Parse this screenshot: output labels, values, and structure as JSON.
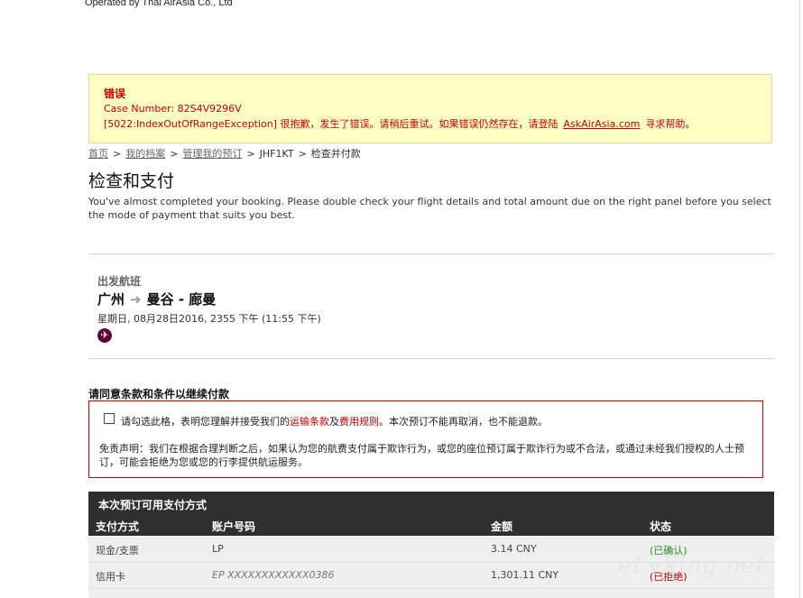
{
  "operated_by": "Operated by Thai AirAsia Co., Ltd",
  "error": {
    "title": "错误",
    "case_number": "Case Number: 82S4V9296V",
    "message_prefix": "[5022:IndexOutOfRangeException] 很抱歉，发生了错误。请稍后重试。如果错误仍然存在，请登陆",
    "link_text": "AskAirAsia.com",
    "message_suffix": "寻求帮助。"
  },
  "breadcrumb": {
    "items": [
      "首页",
      "我的档案",
      "管理我的预订"
    ],
    "booking_code": "JHF1KT",
    "current": "检查并付款",
    "separator": ">"
  },
  "page_title": "检查和支付",
  "intro": "You've almost completed your booking. Please double check your flight details and total amount due on the right panel before you select the mode of payment that suits you best.",
  "flight": {
    "label": "出发航班",
    "origin": "广州",
    "destination": "曼谷 - 廊曼",
    "datetime": "星期日, 08月28日2016, 2355 下午 (11:55 下午)"
  },
  "terms": {
    "heading": "请同意条款和条件以继续付款",
    "agree_prefix": "请勾选此格，表明您理解并接受我们的",
    "link1": "运输条款",
    "and": "及",
    "link2": "费用规则",
    "agree_suffix": "。本次预订不能再取消，也不能退款。",
    "disclaimer": "免责声明：我们在根据合理判断之后，如果认为您的航费支付属于欺诈行为，或您的座位预订属于欺诈行为或不合法，或通过未经我们授权的人士预订，可能会拒绝为您或您的行李提供航运服务。"
  },
  "payments": {
    "title": "本次预订可用支付方式",
    "columns": [
      "支付方式",
      "账户号码",
      "金额",
      "状态"
    ],
    "rows": [
      {
        "method": "现金/支票",
        "account": "LP",
        "amount": "3.14 CNY",
        "status": "(已确认)"
      },
      {
        "method": "信用卡",
        "account": "EP  XXXXXXXXXXXX0386",
        "amount": "1,301.11 CNY",
        "status": "(已拒绝)"
      }
    ]
  },
  "watermark": "eLvXing.net",
  "colors": {
    "error_red": "#c00000",
    "error_bg": "#ffffc4",
    "header_dark": "#2f2f2f",
    "confirmed_green": "#2a8a2a"
  }
}
